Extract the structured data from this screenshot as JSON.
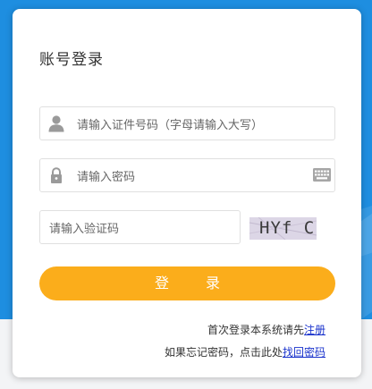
{
  "login": {
    "title": "账号登录",
    "id_placeholder": "请输入证件号码（字母请输入大写）",
    "password_placeholder": "请输入密码",
    "captcha_placeholder": "请输入验证码",
    "captcha_text": "HYf C",
    "login_button": "登 录"
  },
  "footer": {
    "first_login_text": "首次登录本系统请先",
    "register_link": "注册",
    "forgot_text": "如果忘记密码，点击此处",
    "recover_link": "找回密码"
  },
  "icons": {
    "user": "user-icon",
    "lock": "lock-icon",
    "keyboard": "keyboard-icon"
  },
  "colors": {
    "background": "#1e8ee0",
    "button": "#fbad1b",
    "link": "#1a33cc"
  }
}
